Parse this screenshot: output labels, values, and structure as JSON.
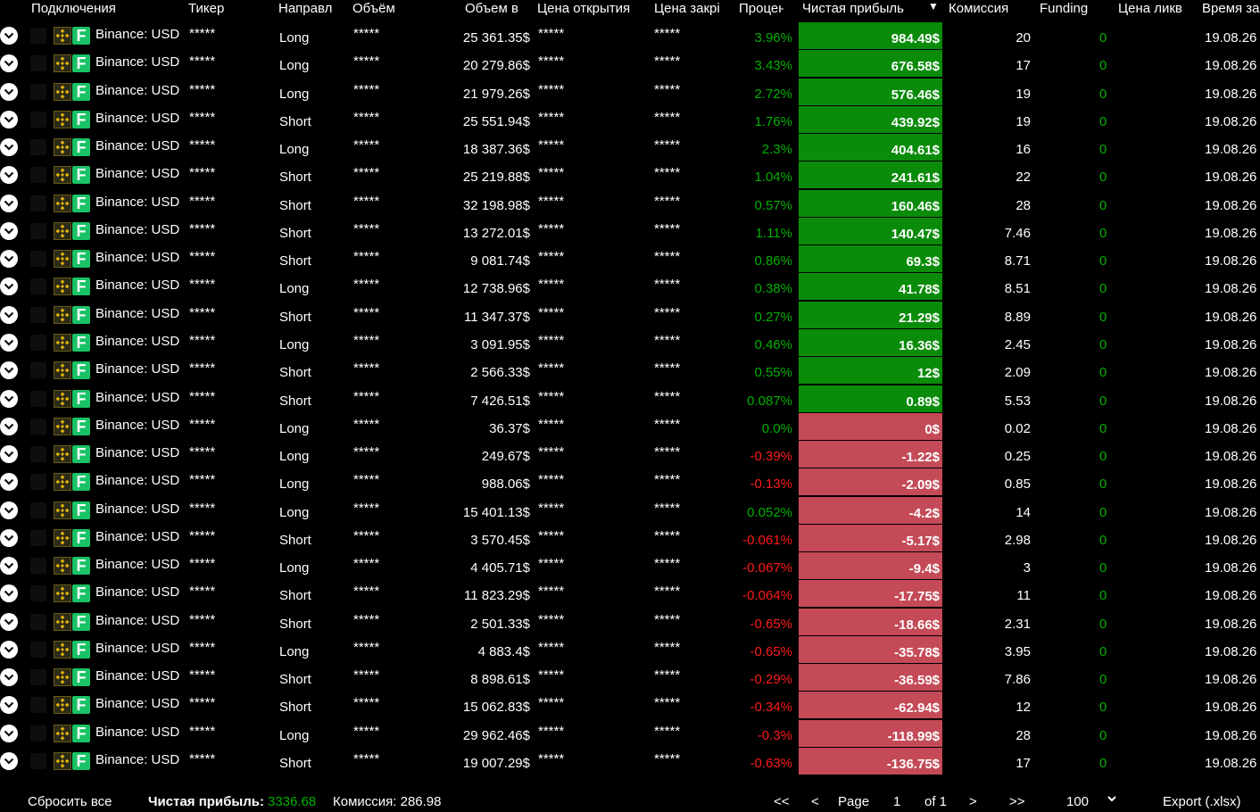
{
  "columns": [
    "Подключения",
    "Тикер",
    "Направл",
    "Объём",
    "Объем в",
    "Цена открытия",
    "Цена закрі",
    "Процен",
    "Чистая прибыль",
    "Комиссия",
    "Funding",
    "Цена ликв",
    "Время за"
  ],
  "sort_icon": "sort-desc-triangle-icon",
  "colors": {
    "positive_bg": "#0a8c0a",
    "negative_bg": "#c44a57",
    "positive_text": "#00b000",
    "negative_text": "#ff1a1a"
  },
  "rows": [
    {
      "connection": "Binance: USD",
      "ticker": "*****",
      "direction": "Long",
      "volume": "*****",
      "volume_usd": "25 361.35$",
      "open": "*****",
      "close": "*****",
      "percent": "3.96%",
      "profit": "984.49$",
      "commission": "20",
      "funding": "0",
      "time": "19.08.26"
    },
    {
      "connection": "Binance: USD",
      "ticker": "*****",
      "direction": "Long",
      "volume": "*****",
      "volume_usd": "20 279.86$",
      "open": "*****",
      "close": "*****",
      "percent": "3.43%",
      "profit": "676.58$",
      "commission": "17",
      "funding": "0",
      "time": "19.08.26"
    },
    {
      "connection": "Binance: USD",
      "ticker": "*****",
      "direction": "Long",
      "volume": "*****",
      "volume_usd": "21 979.26$",
      "open": "*****",
      "close": "*****",
      "percent": "2.72%",
      "profit": "576.46$",
      "commission": "19",
      "funding": "0",
      "time": "19.08.26"
    },
    {
      "connection": "Binance: USD",
      "ticker": "*****",
      "direction": "Short",
      "volume": "*****",
      "volume_usd": "25 551.94$",
      "open": "*****",
      "close": "*****",
      "percent": "1.76%",
      "profit": "439.92$",
      "commission": "19",
      "funding": "0",
      "time": "19.08.26"
    },
    {
      "connection": "Binance: USD",
      "ticker": "*****",
      "direction": "Long",
      "volume": "*****",
      "volume_usd": "18 387.36$",
      "open": "*****",
      "close": "*****",
      "percent": "2.3%",
      "profit": "404.61$",
      "commission": "16",
      "funding": "0",
      "time": "19.08.26"
    },
    {
      "connection": "Binance: USD",
      "ticker": "*****",
      "direction": "Short",
      "volume": "*****",
      "volume_usd": "25 219.88$",
      "open": "*****",
      "close": "*****",
      "percent": "1.04%",
      "profit": "241.61$",
      "commission": "22",
      "funding": "0",
      "time": "19.08.26"
    },
    {
      "connection": "Binance: USD",
      "ticker": "*****",
      "direction": "Short",
      "volume": "*****",
      "volume_usd": "32 198.98$",
      "open": "*****",
      "close": "*****",
      "percent": "0.57%",
      "profit": "160.46$",
      "commission": "28",
      "funding": "0",
      "time": "19.08.26"
    },
    {
      "connection": "Binance: USD",
      "ticker": "*****",
      "direction": "Short",
      "volume": "*****",
      "volume_usd": "13 272.01$",
      "open": "*****",
      "close": "*****",
      "percent": "1.11%",
      "profit": "140.47$",
      "commission": "7.46",
      "funding": "0",
      "time": "19.08.26"
    },
    {
      "connection": "Binance: USD",
      "ticker": "*****",
      "direction": "Short",
      "volume": "*****",
      "volume_usd": "9 081.74$",
      "open": "*****",
      "close": "*****",
      "percent": "0.86%",
      "profit": "69.3$",
      "commission": "8.71",
      "funding": "0",
      "time": "19.08.26"
    },
    {
      "connection": "Binance: USD",
      "ticker": "*****",
      "direction": "Long",
      "volume": "*****",
      "volume_usd": "12 738.96$",
      "open": "*****",
      "close": "*****",
      "percent": "0.38%",
      "profit": "41.78$",
      "commission": "8.51",
      "funding": "0",
      "time": "19.08.26"
    },
    {
      "connection": "Binance: USD",
      "ticker": "*****",
      "direction": "Short",
      "volume": "*****",
      "volume_usd": "11 347.37$",
      "open": "*****",
      "close": "*****",
      "percent": "0.27%",
      "profit": "21.29$",
      "commission": "8.89",
      "funding": "0",
      "time": "19.08.26"
    },
    {
      "connection": "Binance: USD",
      "ticker": "*****",
      "direction": "Long",
      "volume": "*****",
      "volume_usd": "3 091.95$",
      "open": "*****",
      "close": "*****",
      "percent": "0.46%",
      "profit": "16.36$",
      "commission": "2.45",
      "funding": "0",
      "time": "19.08.26"
    },
    {
      "connection": "Binance: USD",
      "ticker": "*****",
      "direction": "Short",
      "volume": "*****",
      "volume_usd": "2 566.33$",
      "open": "*****",
      "close": "*****",
      "percent": "0.55%",
      "profit": "12$",
      "commission": "2.09",
      "funding": "0",
      "time": "19.08.26"
    },
    {
      "connection": "Binance: USD",
      "ticker": "*****",
      "direction": "Short",
      "volume": "*****",
      "volume_usd": "7 426.51$",
      "open": "*****",
      "close": "*****",
      "percent": "0.087%",
      "profit": "0.89$",
      "commission": "5.53",
      "funding": "0",
      "time": "19.08.26"
    },
    {
      "connection": "Binance: USD",
      "ticker": "*****",
      "direction": "Long",
      "volume": "*****",
      "volume_usd": "36.37$",
      "open": "*****",
      "close": "*****",
      "percent": "0.0%",
      "profit": "0$",
      "commission": "0.02",
      "funding": "0",
      "time": "19.08.26"
    },
    {
      "connection": "Binance: USD",
      "ticker": "*****",
      "direction": "Long",
      "volume": "*****",
      "volume_usd": "249.67$",
      "open": "*****",
      "close": "*****",
      "percent": "-0.39%",
      "profit": "-1.22$",
      "commission": "0.25",
      "funding": "0",
      "time": "19.08.26"
    },
    {
      "connection": "Binance: USD",
      "ticker": "*****",
      "direction": "Long",
      "volume": "*****",
      "volume_usd": "988.06$",
      "open": "*****",
      "close": "*****",
      "percent": "-0.13%",
      "profit": "-2.09$",
      "commission": "0.85",
      "funding": "0",
      "time": "19.08.26"
    },
    {
      "connection": "Binance: USD",
      "ticker": "*****",
      "direction": "Long",
      "volume": "*****",
      "volume_usd": "15 401.13$",
      "open": "*****",
      "close": "*****",
      "percent": "0.052%",
      "profit": "-4.2$",
      "commission": "14",
      "funding": "0",
      "time": "19.08.26"
    },
    {
      "connection": "Binance: USD",
      "ticker": "*****",
      "direction": "Short",
      "volume": "*****",
      "volume_usd": "3 570.45$",
      "open": "*****",
      "close": "*****",
      "percent": "-0.061%",
      "profit": "-5.17$",
      "commission": "2.98",
      "funding": "0",
      "time": "19.08.26"
    },
    {
      "connection": "Binance: USD",
      "ticker": "*****",
      "direction": "Long",
      "volume": "*****",
      "volume_usd": "4 405.71$",
      "open": "*****",
      "close": "*****",
      "percent": "-0.067%",
      "profit": "-9.4$",
      "commission": "3",
      "funding": "0",
      "time": "19.08.26"
    },
    {
      "connection": "Binance: USD",
      "ticker": "*****",
      "direction": "Short",
      "volume": "*****",
      "volume_usd": "11 823.29$",
      "open": "*****",
      "close": "*****",
      "percent": "-0.064%",
      "profit": "-17.75$",
      "commission": "11",
      "funding": "0",
      "time": "19.08.26"
    },
    {
      "connection": "Binance: USD",
      "ticker": "*****",
      "direction": "Short",
      "volume": "*****",
      "volume_usd": "2 501.33$",
      "open": "*****",
      "close": "*****",
      "percent": "-0.65%",
      "profit": "-18.66$",
      "commission": "2.31",
      "funding": "0",
      "time": "19.08.26"
    },
    {
      "connection": "Binance: USD",
      "ticker": "*****",
      "direction": "Long",
      "volume": "*****",
      "volume_usd": "4 883.4$",
      "open": "*****",
      "close": "*****",
      "percent": "-0.65%",
      "profit": "-35.78$",
      "commission": "3.95",
      "funding": "0",
      "time": "19.08.26"
    },
    {
      "connection": "Binance: USD",
      "ticker": "*****",
      "direction": "Short",
      "volume": "*****",
      "volume_usd": "8 898.61$",
      "open": "*****",
      "close": "*****",
      "percent": "-0.29%",
      "profit": "-36.59$",
      "commission": "7.86",
      "funding": "0",
      "time": "19.08.26"
    },
    {
      "connection": "Binance: USD",
      "ticker": "*****",
      "direction": "Short",
      "volume": "*****",
      "volume_usd": "15 062.83$",
      "open": "*****",
      "close": "*****",
      "percent": "-0.34%",
      "profit": "-62.94$",
      "commission": "12",
      "funding": "0",
      "time": "19.08.26"
    },
    {
      "connection": "Binance: USD",
      "ticker": "*****",
      "direction": "Long",
      "volume": "*****",
      "volume_usd": "29 962.46$",
      "open": "*****",
      "close": "*****",
      "percent": "-0.3%",
      "profit": "-118.99$",
      "commission": "28",
      "funding": "0",
      "time": "19.08.26"
    },
    {
      "connection": "Binance: USD",
      "ticker": "*****",
      "direction": "Short",
      "volume": "*****",
      "volume_usd": "19 007.29$",
      "open": "*****",
      "close": "*****",
      "percent": "-0.63%",
      "profit": "-136.75$",
      "commission": "17",
      "funding": "0",
      "time": "19.08.26"
    }
  ],
  "footer": {
    "reset_label": "Сбросить все",
    "net_profit_label": "Чистая прибыль:",
    "net_profit_value": "3336.68",
    "commission_text": "Комиссия: 286.98",
    "first_label": "<<",
    "prev_label": "<",
    "page_label": "Page",
    "page_value": "1",
    "of_label": "of 1",
    "next_label": ">",
    "last_label": ">>",
    "page_size": "100",
    "export_label": "Export (.xlsx)"
  }
}
